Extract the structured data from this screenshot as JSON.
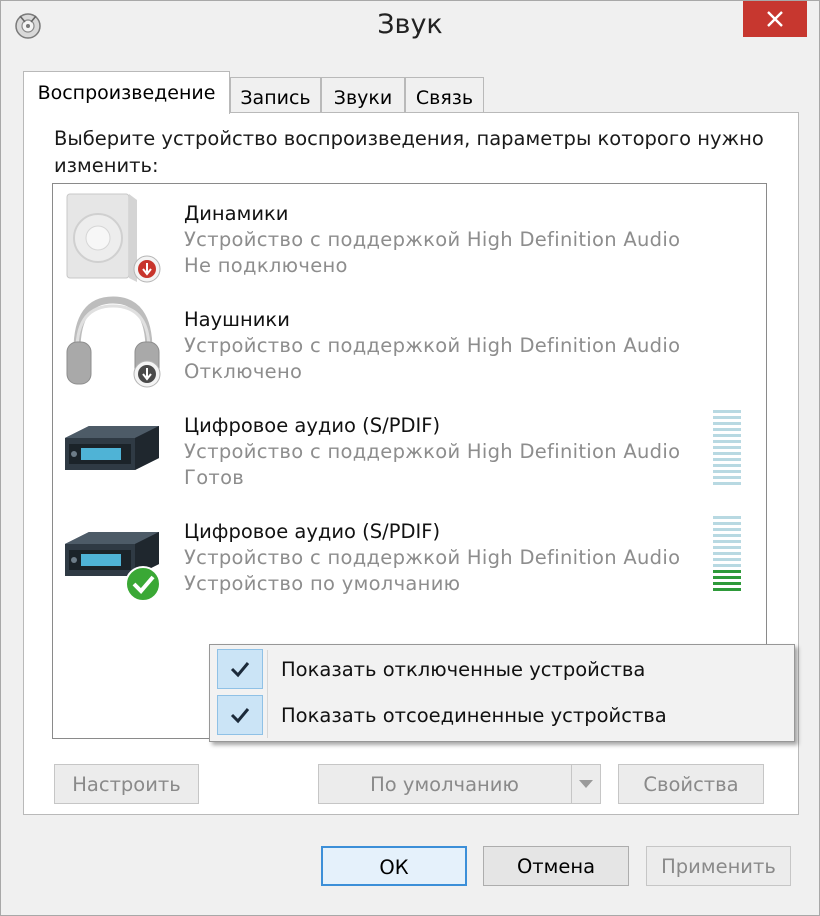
{
  "window": {
    "title": "Звук"
  },
  "tabs": [
    {
      "label": "Воспроизведение",
      "active": true
    },
    {
      "label": "Запись",
      "active": false
    },
    {
      "label": "Звуки",
      "active": false
    },
    {
      "label": "Связь",
      "active": false
    }
  ],
  "instruction": "Выберите устройство воспроизведения, параметры которого нужно изменить:",
  "devices": [
    {
      "name": "Динамики",
      "description": "Устройство с поддержкой High Definition Audio",
      "status": "Не подключено",
      "icon": "speaker-icon",
      "badge": "disconnected-badge-icon"
    },
    {
      "name": "Наушники",
      "description": "Устройство с поддержкой High Definition Audio",
      "status": "Отключено",
      "icon": "headphones-icon",
      "badge": "disabled-badge-icon"
    },
    {
      "name": "Цифровое аудио (S/PDIF)",
      "description": "Устройство с поддержкой High Definition Audio",
      "status": "Готов",
      "icon": "digital-audio-device-icon",
      "badge": ""
    },
    {
      "name": "Цифровое аудио (S/PDIF)",
      "description": "Устройство с поддержкой High Definition Audio",
      "status": "Устройство по умолчанию",
      "icon": "digital-audio-device-icon",
      "badge": "default-check-badge-icon"
    }
  ],
  "context_menu": {
    "items": [
      {
        "label": "Показать отключенные устройства",
        "checked": true
      },
      {
        "label": "Показать отсоединенные устройства",
        "checked": true
      }
    ]
  },
  "panel_buttons": {
    "configure": "Настроить",
    "set_default": "По умолчанию",
    "properties": "Свойства"
  },
  "dialog_buttons": {
    "ok": "ОК",
    "cancel": "Отмена",
    "apply": "Применить"
  },
  "colors": {
    "close_button": "#c7372f",
    "meter_idle": "#b8d9e2",
    "meter_active": "#2e9a3a",
    "check_highlight": "#cbe4f6",
    "focus_border": "#3c8fd8"
  }
}
